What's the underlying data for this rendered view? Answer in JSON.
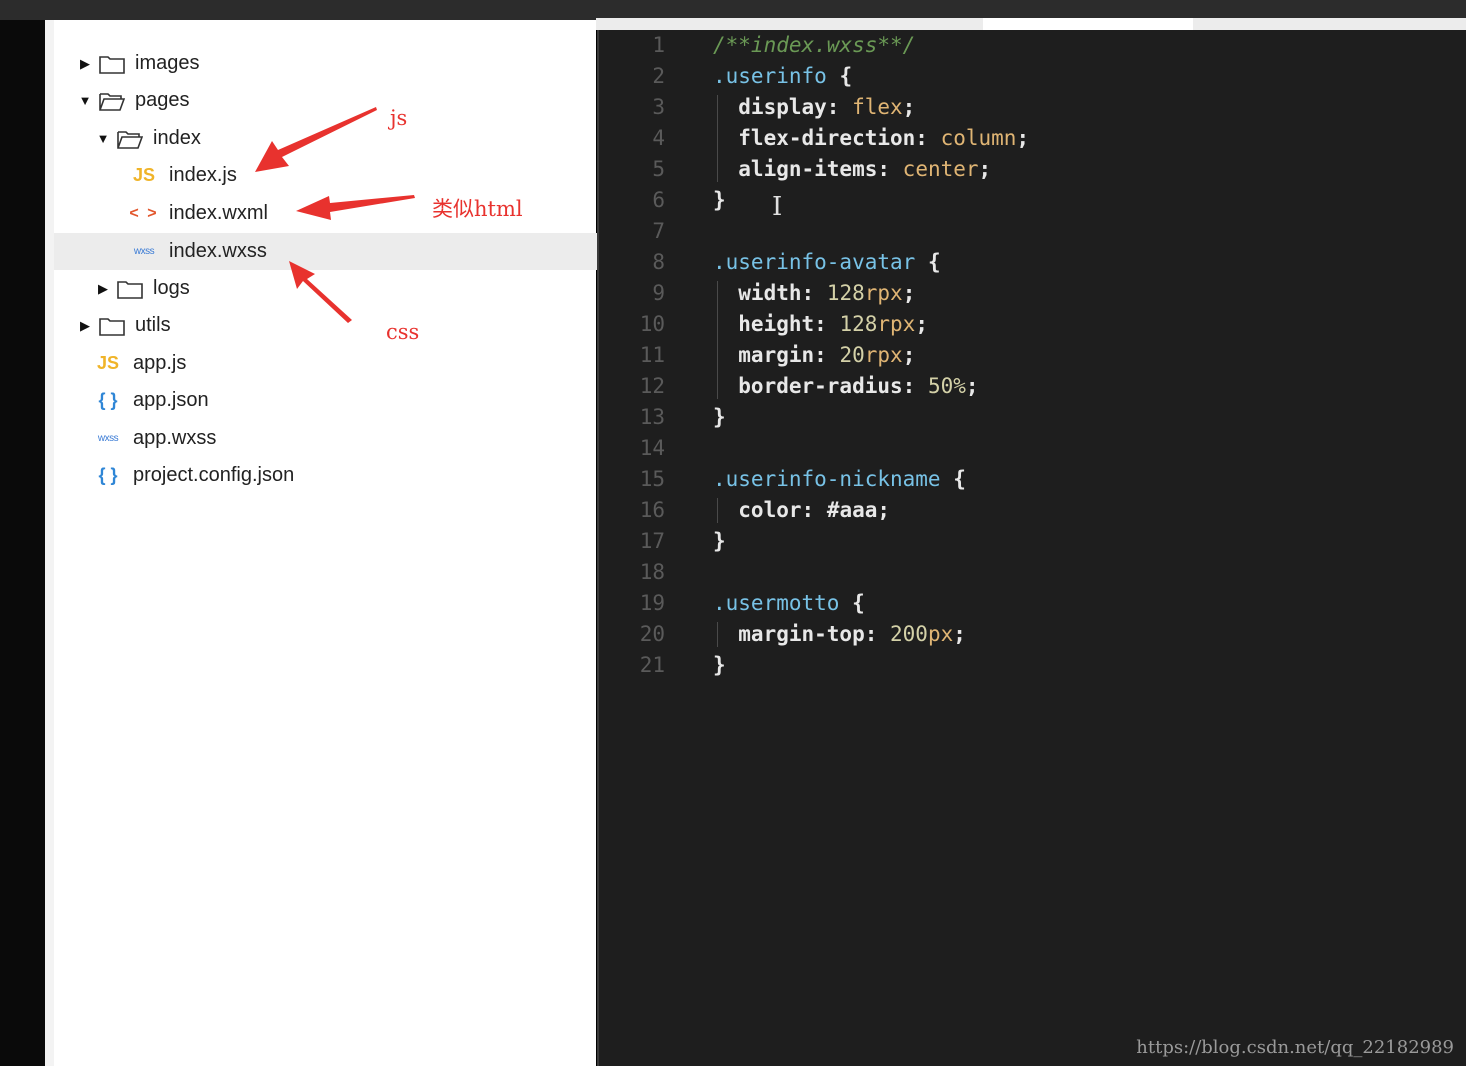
{
  "colors": {
    "annotation": "#e8322e",
    "editor_bg": "#1e1e1e",
    "sidebar_bg": "#ffffff",
    "selected_row": "#ececec"
  },
  "tree": {
    "items": [
      {
        "label": "images",
        "icon": "folder-icon",
        "caret": "right"
      },
      {
        "label": "pages",
        "icon": "folder-open-icon",
        "caret": "down"
      },
      {
        "label": "index",
        "icon": "folder-open-icon",
        "caret": "down"
      },
      {
        "label": "index.js",
        "icon": "js-file-icon",
        "icon_text": "JS"
      },
      {
        "label": "index.wxml",
        "icon": "wxml-file-icon",
        "icon_text": "< >"
      },
      {
        "label": "index.wxss",
        "icon": "wxss-file-icon",
        "icon_text": "wxss",
        "selected": true
      },
      {
        "label": "logs",
        "icon": "folder-icon",
        "caret": "right"
      },
      {
        "label": "utils",
        "icon": "folder-icon",
        "caret": "right"
      },
      {
        "label": "app.js",
        "icon": "js-file-icon",
        "icon_text": "JS"
      },
      {
        "label": "app.json",
        "icon": "json-file-icon",
        "icon_text": "{ }"
      },
      {
        "label": "app.wxss",
        "icon": "wxss-file-icon",
        "icon_text": "wxss"
      },
      {
        "label": "project.config.json",
        "icon": "json-file-icon",
        "icon_text": "{ }"
      }
    ]
  },
  "annotations": {
    "js": "js",
    "html": "类似html",
    "css": "css"
  },
  "editor": {
    "lines": [
      {
        "n": "1",
        "tokens": [
          {
            "t": "/**index.wxss**/",
            "c": "comment"
          }
        ]
      },
      {
        "n": "2",
        "tokens": [
          {
            "t": ".userinfo ",
            "c": "sel"
          },
          {
            "t": "{",
            "c": "punc"
          }
        ]
      },
      {
        "n": "3",
        "tokens": [
          {
            "t": "  display",
            "c": "prop"
          },
          {
            "t": ": ",
            "c": "punc"
          },
          {
            "t": "flex",
            "c": "val"
          },
          {
            "t": ";",
            "c": "punc"
          }
        ]
      },
      {
        "n": "4",
        "tokens": [
          {
            "t": "  flex-direction",
            "c": "prop"
          },
          {
            "t": ": ",
            "c": "punc"
          },
          {
            "t": "column",
            "c": "val"
          },
          {
            "t": ";",
            "c": "punc"
          }
        ]
      },
      {
        "n": "5",
        "tokens": [
          {
            "t": "  align-items",
            "c": "prop"
          },
          {
            "t": ": ",
            "c": "punc"
          },
          {
            "t": "center",
            "c": "val"
          },
          {
            "t": ";",
            "c": "punc"
          }
        ]
      },
      {
        "n": "6",
        "tokens": [
          {
            "t": "}",
            "c": "punc"
          }
        ]
      },
      {
        "n": "7",
        "tokens": []
      },
      {
        "n": "8",
        "tokens": [
          {
            "t": ".userinfo-avatar ",
            "c": "sel"
          },
          {
            "t": "{",
            "c": "punc"
          }
        ]
      },
      {
        "n": "9",
        "tokens": [
          {
            "t": "  width",
            "c": "prop"
          },
          {
            "t": ": ",
            "c": "punc"
          },
          {
            "t": "128",
            "c": "num"
          },
          {
            "t": "rpx",
            "c": "unit"
          },
          {
            "t": ";",
            "c": "punc"
          }
        ]
      },
      {
        "n": "10",
        "tokens": [
          {
            "t": "  height",
            "c": "prop"
          },
          {
            "t": ": ",
            "c": "punc"
          },
          {
            "t": "128",
            "c": "num"
          },
          {
            "t": "rpx",
            "c": "unit"
          },
          {
            "t": ";",
            "c": "punc"
          }
        ]
      },
      {
        "n": "11",
        "tokens": [
          {
            "t": "  margin",
            "c": "prop"
          },
          {
            "t": ": ",
            "c": "punc"
          },
          {
            "t": "20",
            "c": "num"
          },
          {
            "t": "rpx",
            "c": "unit"
          },
          {
            "t": ";",
            "c": "punc"
          }
        ]
      },
      {
        "n": "12",
        "tokens": [
          {
            "t": "  border-radius",
            "c": "prop"
          },
          {
            "t": ": ",
            "c": "punc"
          },
          {
            "t": "50%",
            "c": "num"
          },
          {
            "t": ";",
            "c": "punc"
          }
        ]
      },
      {
        "n": "13",
        "tokens": [
          {
            "t": "}",
            "c": "punc"
          }
        ]
      },
      {
        "n": "14",
        "tokens": []
      },
      {
        "n": "15",
        "tokens": [
          {
            "t": ".userinfo-nickname ",
            "c": "sel"
          },
          {
            "t": "{",
            "c": "punc"
          }
        ]
      },
      {
        "n": "16",
        "tokens": [
          {
            "t": "  color",
            "c": "prop"
          },
          {
            "t": ": ",
            "c": "punc"
          },
          {
            "t": "#aaa",
            "c": "prop"
          },
          {
            "t": ";",
            "c": "punc"
          }
        ]
      },
      {
        "n": "17",
        "tokens": [
          {
            "t": "}",
            "c": "punc"
          }
        ]
      },
      {
        "n": "18",
        "tokens": []
      },
      {
        "n": "19",
        "tokens": [
          {
            "t": ".usermotto ",
            "c": "sel"
          },
          {
            "t": "{",
            "c": "punc"
          }
        ]
      },
      {
        "n": "20",
        "tokens": [
          {
            "t": "  margin-top",
            "c": "prop"
          },
          {
            "t": ": ",
            "c": "punc"
          },
          {
            "t": "200",
            "c": "num"
          },
          {
            "t": "px",
            "c": "unit"
          },
          {
            "t": ";",
            "c": "punc"
          }
        ]
      },
      {
        "n": "21",
        "tokens": [
          {
            "t": "}",
            "c": "punc"
          }
        ]
      }
    ]
  },
  "watermark": "https://blog.csdn.net/qq_22182989"
}
